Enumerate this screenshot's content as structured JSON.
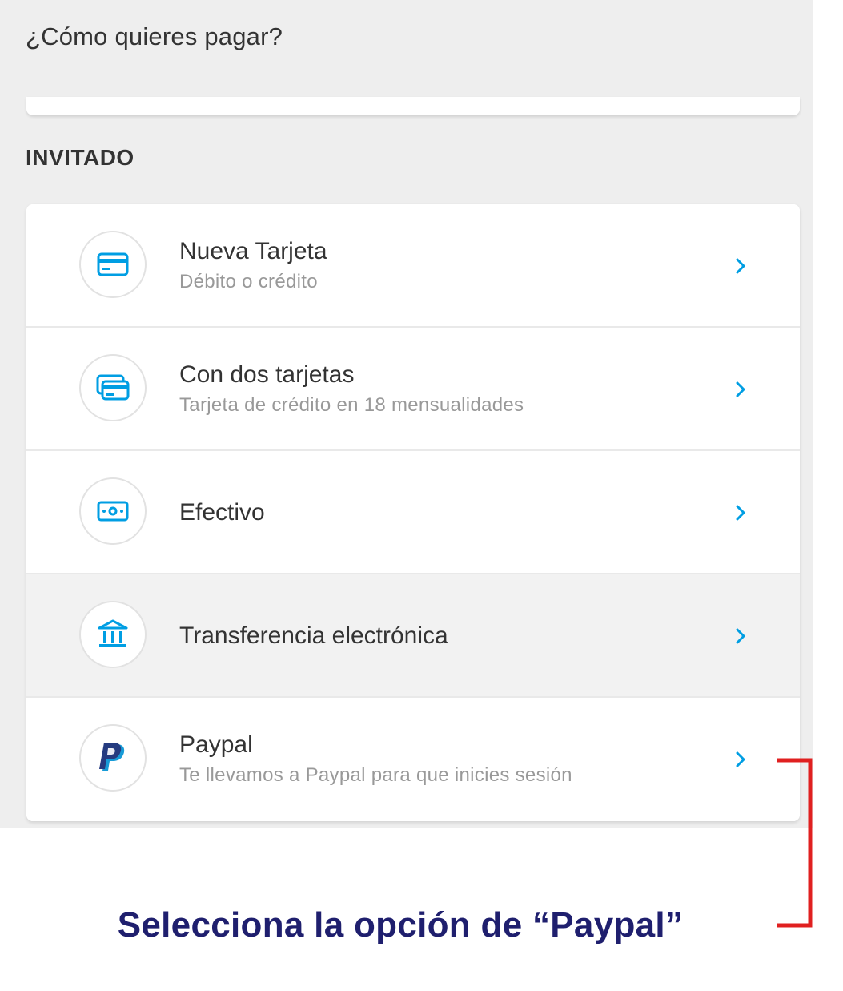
{
  "header": {
    "title": "¿Cómo quieres pagar?"
  },
  "section": {
    "label": "INVITADO"
  },
  "colors": {
    "accent": "#009ee3",
    "paypal_dark": "#253b80",
    "paypal_light": "#179bd7",
    "annotation": "#e02020",
    "caption": "#1f1f6e"
  },
  "options": [
    {
      "title": "Nueva Tarjeta",
      "subtitle": "Débito o crédito",
      "icon": "credit-card-icon"
    },
    {
      "title": "Con dos tarjetas",
      "subtitle": "Tarjeta de crédito en 18 mensualidades",
      "icon": "two-cards-icon"
    },
    {
      "title": "Efectivo",
      "subtitle": "",
      "icon": "cash-icon"
    },
    {
      "title": "Transferencia electrónica",
      "subtitle": "",
      "icon": "bank-icon"
    },
    {
      "title": "Paypal",
      "subtitle": "Te llevamos a Paypal para que inicies sesión",
      "icon": "paypal-icon"
    }
  ],
  "annotation": {
    "caption": "Selecciona la opción de “Paypal”"
  }
}
